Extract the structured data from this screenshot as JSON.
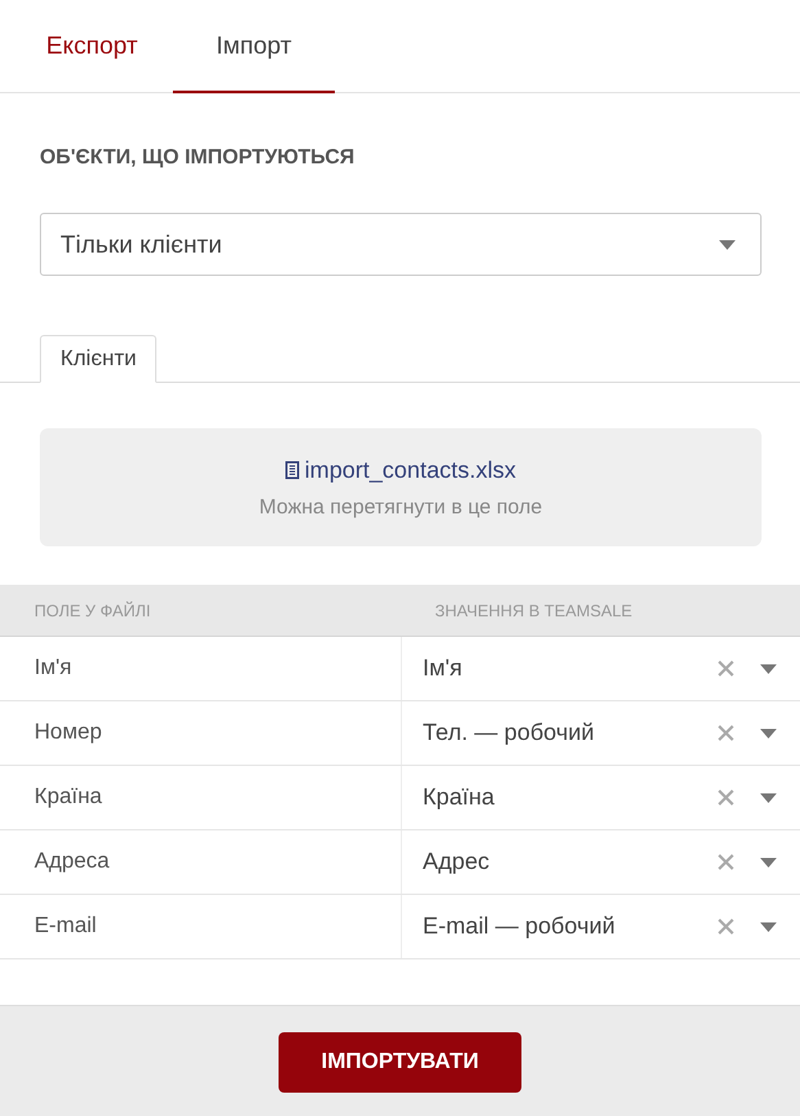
{
  "tabs": [
    {
      "label": "Експорт",
      "selected": false
    },
    {
      "label": "Імпорт",
      "selected": true
    }
  ],
  "section_label": "ОБ'ЄКТИ, ЩО ІМПОРТУЮТЬСЯ",
  "object_select": {
    "value": "Тільки клієнти"
  },
  "subtabs": [
    {
      "label": "Клієнти",
      "selected": true
    }
  ],
  "drop_zone": {
    "file_name": "import_contacts.xlsx",
    "hint": "Можна перетягнути в це поле"
  },
  "mapping_table": {
    "columns": [
      "ПОЛЕ У ФАЙЛІ",
      "ЗНАЧЕННЯ В TEAMSALE"
    ],
    "rows": [
      {
        "file_field": "Ім'я",
        "value": "Ім'я"
      },
      {
        "file_field": "Номер",
        "value": "Тел. — робочий"
      },
      {
        "file_field": "Країна",
        "value": "Країна"
      },
      {
        "file_field": "Адреса",
        "value": "Адрес"
      },
      {
        "file_field": "E-mail",
        "value": "E-mail — робочий"
      }
    ]
  },
  "import_button": "ІМПОРТУВАТИ"
}
